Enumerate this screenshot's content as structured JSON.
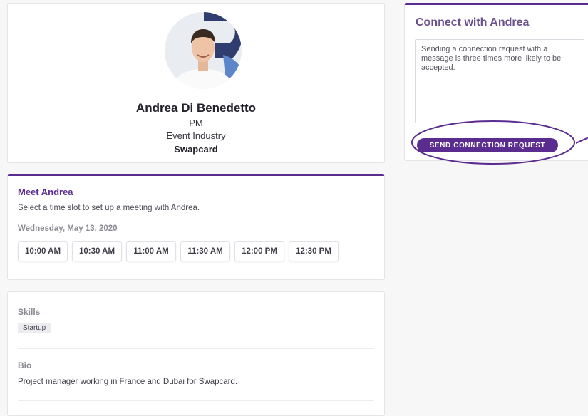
{
  "profile": {
    "name": "Andrea Di Benedetto",
    "job_title": "PM",
    "industry": "Event Industry",
    "company": "Swapcard"
  },
  "connect": {
    "title": "Connect with Andrea",
    "message": "Sending a connection request with a message is three times more likely to be accepted.",
    "button_label": "SEND CONNECTION REQUEST",
    "highlight_color": "#5b2c8f"
  },
  "meet": {
    "title": "Meet Andrea",
    "subtitle": "Select a time slot to set up a meeting with Andrea.",
    "date": "Wednesday, May 13, 2020",
    "slots": [
      "10:00 AM",
      "10:30 AM",
      "11:00 AM",
      "11:30 AM",
      "12:00 PM",
      "12:30 PM"
    ]
  },
  "details": {
    "skills_label": "Skills",
    "skills": [
      "Startup"
    ],
    "bio_label": "Bio",
    "bio": "Project manager working in France and Dubai for Swapcard."
  },
  "colors": {
    "accent": "#5b2c8f",
    "background": "#f7f7f8"
  }
}
